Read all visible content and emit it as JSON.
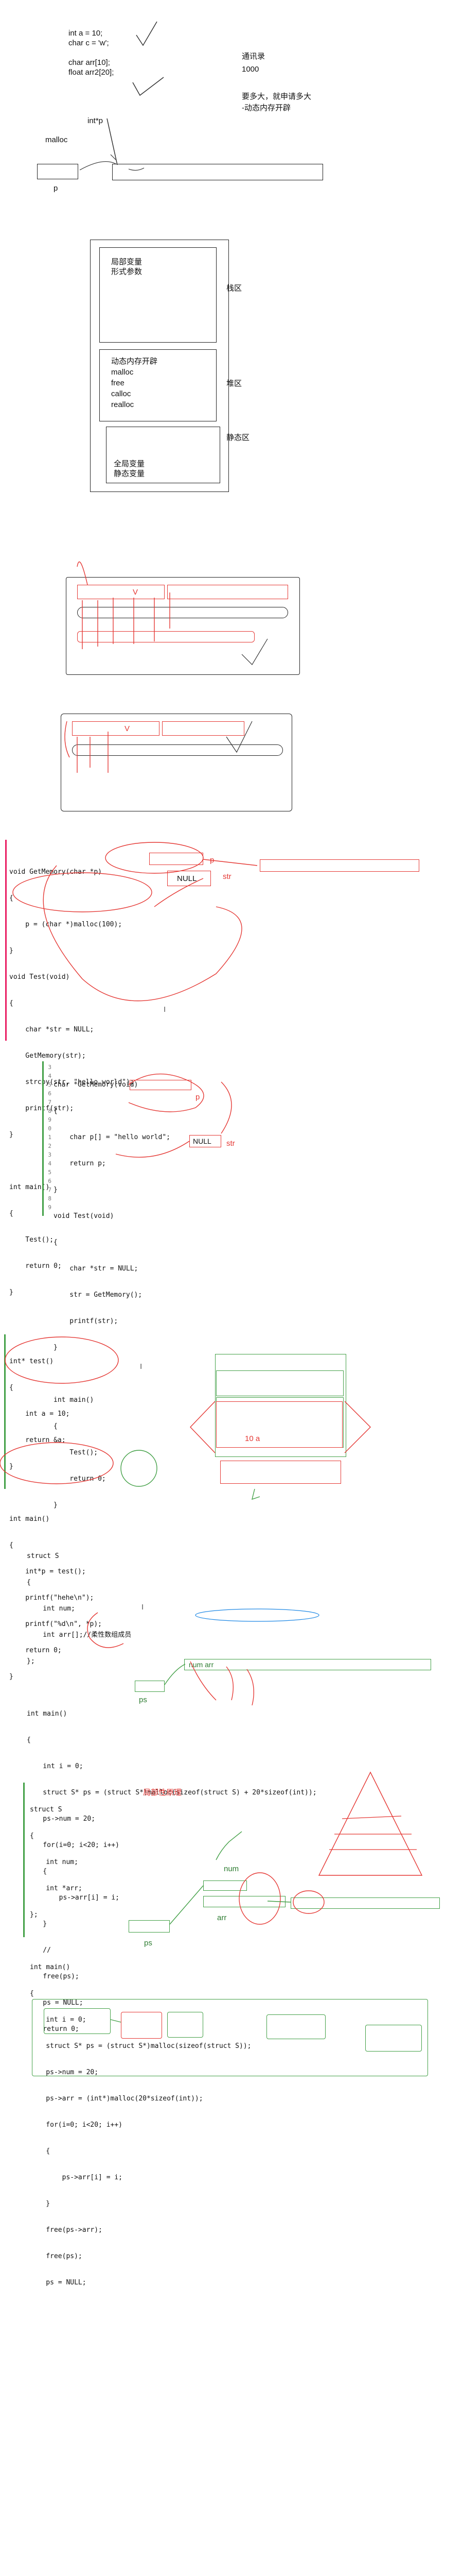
{
  "sec1": {
    "code_lines": [
      "int a = 10;",
      "char c = 'w';",
      "",
      "char arr[10];",
      "float arr2[20];"
    ],
    "int_ptr": "int*p",
    "malloc": "malloc",
    "p": "p",
    "tongxunlu": "通讯录",
    "n1000": "1000",
    "need_line1": "要多大，就申请多大",
    "need_line2": "-动态内存开辟"
  },
  "mem": {
    "stack_items": [
      "局部变量",
      "形式参数"
    ],
    "stack_label": "栈区",
    "heap_items": [
      "动态内存开辟",
      "malloc",
      "free",
      "calloc",
      "realloc"
    ],
    "heap_label": "堆区",
    "static_items": [
      "全局变量",
      "静态变量"
    ],
    "static_label": "静态区"
  },
  "sketch": {
    "v1": "V",
    "v2": "V"
  },
  "code1": {
    "lines": [
      "void GetMemory(char *p)",
      "{",
      "    p = (char *)malloc(100);",
      "}",
      "void Test(void)",
      "{",
      "    char *str = NULL;",
      "    GetMemory(str);",
      "    strcpy(str, \"hello world\");",
      "    printf(str);",
      "}",
      "",
      "int main()",
      "{",
      "    Test();",
      "    return 0;",
      "}"
    ],
    "p_label": "p",
    "null_label": "NULL",
    "str_label": "str",
    "cursor": "I"
  },
  "code2": {
    "gutter": [
      "3",
      "4",
      "5",
      "6",
      "7",
      "8",
      "9",
      "0",
      "1",
      "2",
      "3",
      "4",
      "5",
      "6",
      "7",
      "8",
      "9"
    ],
    "lines": [
      "char *GetMemory(void)",
      "{",
      "    char p[] = \"hello world\";",
      "    return p;",
      "}",
      "void Test(void)",
      "{",
      "    char *str = NULL;",
      "    str = GetMemory();",
      "    printf(str);",
      "}",
      "",
      "int main()",
      "{",
      "    Test();",
      "    return 0;",
      "}"
    ],
    "p_label": "p",
    "null_label": "NULL",
    "str_label": "str"
  },
  "code3": {
    "lines": [
      "int* test()",
      "{",
      "    int a = 10;",
      "    return &a;",
      "}",
      "",
      "int main()",
      "{",
      "    int*p = test();",
      "    printf(\"hehe\\n\");",
      "    printf(\"%d\\n\", *p);",
      "    return 0;",
      "}"
    ],
    "stack_value": "10  a",
    "cursor": "I"
  },
  "code4": {
    "lines": [
      "struct S",
      "{",
      "    int num;",
      "    int arr[];//柔性数组成员",
      "};",
      "",
      "int main()",
      "{",
      "    int i = 0;",
      "    struct S* ps = (struct S*)malloc(sizeof(struct S) + 20*sizeof(int));",
      "    ps->num = 20;",
      "    for(i=0; i<20; i++)",
      "    {",
      "        ps->arr[i] = i;",
      "    }",
      "    //",
      "    free(ps);",
      "    ps = NULL;",
      "    return 0;"
    ],
    "num_arr": "num  arr",
    "ps": "ps",
    "cursor": "I"
  },
  "code5": {
    "title": "局部性原理",
    "lines": [
      "struct S",
      "{",
      "    int num;",
      "    int *arr;",
      "};",
      "",
      "int main()",
      "{",
      "    int i = 0;",
      "    struct S* ps = (struct S*)malloc(sizeof(struct S));",
      "    ps->num = 20;",
      "    ps->arr = (int*)malloc(20*sizeof(int));",
      "    for(i=0; i<20; i++)",
      "    {",
      "        ps->arr[i] = i;",
      "    }",
      "    free(ps->arr);",
      "    free(ps);",
      "    ps = NULL;"
    ],
    "num": "num",
    "arr": "arr",
    "ps": "ps"
  }
}
